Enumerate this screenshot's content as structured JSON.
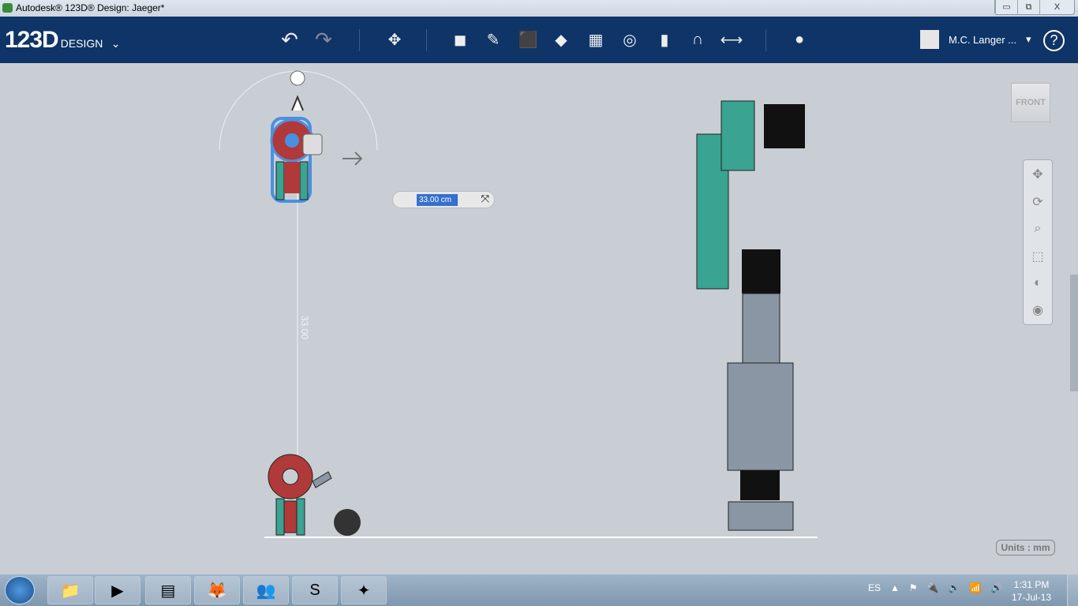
{
  "window": {
    "title": "Autodesk® 123D® Design: Jaeger*",
    "minimize": "▭",
    "restore": "⧉",
    "close": "X"
  },
  "toolbar": {
    "brand": "123D",
    "brand_sub": "DESIGN",
    "brand_menu": "⌄",
    "undo": "↶",
    "redo": "↷",
    "tools": [
      {
        "name": "transform-icon",
        "glyph": "✥"
      },
      {
        "name": "primitives-icon",
        "glyph": "◼"
      },
      {
        "name": "sketch-icon",
        "glyph": "✎"
      },
      {
        "name": "construct-icon",
        "glyph": "⬛"
      },
      {
        "name": "modify-icon",
        "glyph": "◆"
      },
      {
        "name": "pattern-icon",
        "glyph": "▦"
      },
      {
        "name": "grouping-icon",
        "glyph": "◎"
      },
      {
        "name": "combine-icon",
        "glyph": "▮"
      },
      {
        "name": "snap-icon",
        "glyph": "∩"
      },
      {
        "name": "measure-icon",
        "glyph": "⟷"
      },
      {
        "name": "material-icon",
        "glyph": "●"
      }
    ],
    "user": "M.C. Langer ...",
    "user_menu": "▾",
    "help": "?"
  },
  "viewport": {
    "dimension_input": "33.00 cm",
    "dimension_label": "33.00",
    "viewcube": "FRONT",
    "units": "Units : mm",
    "colors": {
      "selection": "#4a90e2",
      "red_part": "#b03a3a",
      "teal_part": "#3aa391",
      "grey_part": "#8a96a4"
    }
  },
  "navbar": [
    {
      "name": "pan-icon",
      "glyph": "✥"
    },
    {
      "name": "orbit-icon",
      "glyph": "⟳"
    },
    {
      "name": "zoom-icon",
      "glyph": "⌕"
    },
    {
      "name": "fit-icon",
      "glyph": "⬚"
    },
    {
      "name": "visual-style-icon",
      "glyph": "◐"
    },
    {
      "name": "visibility-icon",
      "glyph": "◉"
    }
  ],
  "taskbar": {
    "apps": [
      {
        "name": "explorer-icon",
        "glyph": "📁"
      },
      {
        "name": "media-player-icon",
        "glyph": "▶"
      },
      {
        "name": "app-icon",
        "glyph": "▤"
      },
      {
        "name": "firefox-icon",
        "glyph": "🦊"
      },
      {
        "name": "messenger-icon",
        "glyph": "👥"
      },
      {
        "name": "skype-icon",
        "glyph": "S"
      },
      {
        "name": "123d-icon",
        "glyph": "✦"
      }
    ],
    "lang": "ES",
    "tray": [
      "▲",
      "⚑",
      "🔌",
      "🔈",
      "📶",
      "🔊"
    ],
    "time": "1:31 PM",
    "date": "17-Jul-13"
  }
}
